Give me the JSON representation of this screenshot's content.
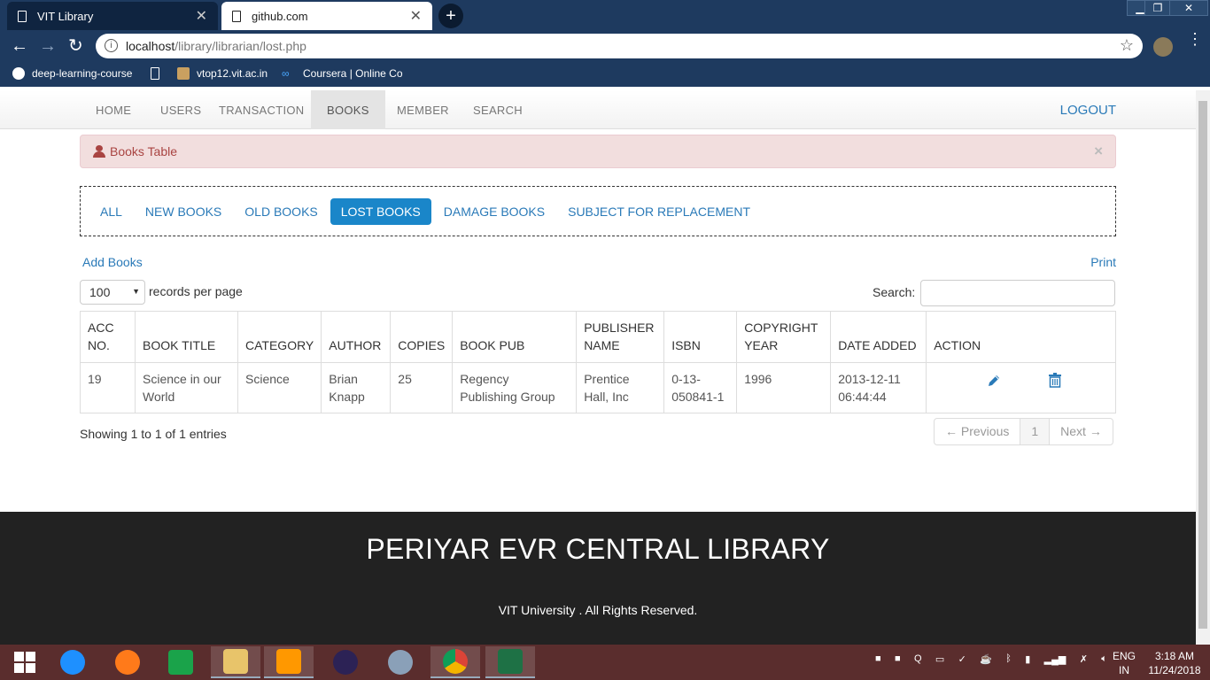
{
  "browser": {
    "tabs": [
      {
        "title": "VIT Library",
        "active": true
      },
      {
        "title": "github.com",
        "active": false
      }
    ],
    "address": {
      "host": "localhost",
      "path": "/library/librarian/lost.php"
    },
    "bookmarks": [
      "deep-learning-course",
      "vtop12.vit.ac.in",
      "Coursera | Online Co"
    ]
  },
  "navbar": {
    "items": [
      "HOME",
      "USERS",
      "TRANSACTION",
      "BOOKS",
      "MEMBER",
      "SEARCH"
    ],
    "active": "BOOKS",
    "logout": "LOGOUT"
  },
  "alert": {
    "title": "Books Table",
    "close": "×"
  },
  "filters": [
    "ALL",
    "NEW BOOKS",
    "OLD BOOKS",
    "LOST BOOKS",
    "DAMAGE BOOKS",
    "SUBJECT FOR REPLACEMENT"
  ],
  "filters_active": "LOST BOOKS",
  "actions": {
    "add": "Add Books",
    "print": "Print"
  },
  "length": {
    "value": "100",
    "label": "records per page"
  },
  "search": {
    "label": "Search:",
    "value": ""
  },
  "table": {
    "headers": [
      [
        "ACC",
        "NO."
      ],
      [
        "BOOK TITLE"
      ],
      [
        "CATEGORY"
      ],
      [
        "AUTHOR"
      ],
      [
        "COPIES"
      ],
      [
        "BOOK PUB"
      ],
      [
        "PUBLISHER",
        "NAME"
      ],
      [
        "ISBN"
      ],
      [
        "COPYRIGHT",
        "YEAR"
      ],
      [
        "DATE ADDED"
      ],
      [
        "ACTION"
      ]
    ],
    "rows": [
      {
        "acc_no": "19",
        "title": [
          "Science in our",
          "World"
        ],
        "category": "Science",
        "author": [
          "Brian",
          "Knapp"
        ],
        "copies": "25",
        "book_pub": [
          "Regency",
          "Publishing Group"
        ],
        "publisher": [
          "Prentice",
          "Hall, Inc"
        ],
        "isbn": [
          "0-13-",
          "050841-1"
        ],
        "copyright_year": "1996",
        "date_added": [
          "2013-12-11",
          "06:44:44"
        ]
      }
    ]
  },
  "info": "Showing 1 to 1 of 1 entries",
  "pager": {
    "prev": "← Previous",
    "current": "1",
    "next": "Next →"
  },
  "footer": {
    "title": "PERIYAR EVR CENTRAL LIBRARY",
    "copy": "VIT University . All Rights Reserved."
  },
  "taskbar": {
    "lang": [
      "ENG",
      "IN"
    ],
    "time": "3:18 AM",
    "date": "11/24/2018"
  },
  "colors": {
    "link": "#2a7ab8",
    "active_pill": "#1a86c9",
    "alert_bg": "#f2dede",
    "alert_text": "#a94442",
    "footer_bg": "#222222",
    "chrome": "#1e3a5f"
  }
}
